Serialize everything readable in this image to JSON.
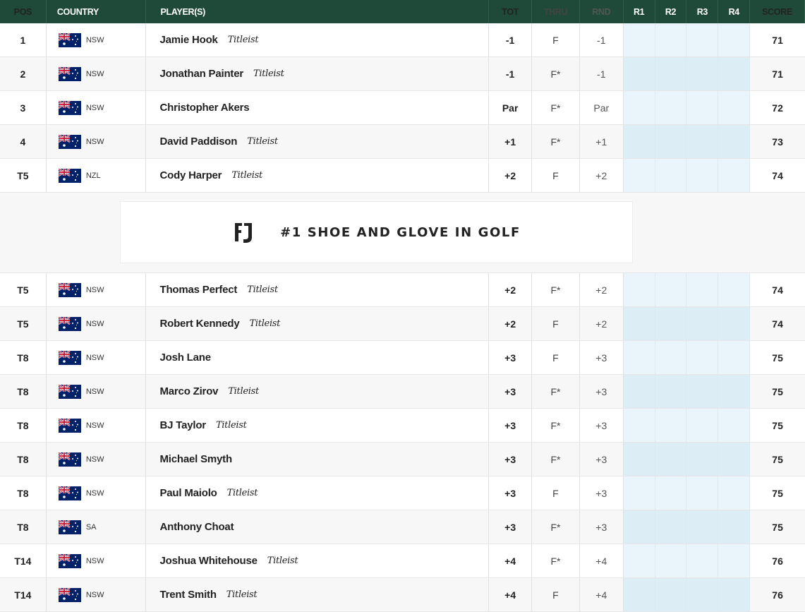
{
  "header": {
    "pos": "POS",
    "country": "COUNTRY",
    "players": "PLAYER(S)",
    "tot": "TOT",
    "thru": "THRU",
    "rnd": "RND",
    "r1": "R1",
    "r2": "R2",
    "r3": "R3",
    "r4": "R4",
    "score": "SCORE"
  },
  "rows_top": [
    {
      "pos": "1",
      "region": "NSW",
      "name": "Jamie Hook",
      "sponsor": "Titleist",
      "tot": "-1",
      "thru": "F",
      "rnd": "-1",
      "score": "71"
    },
    {
      "pos": "2",
      "region": "NSW",
      "name": "Jonathan Painter",
      "sponsor": "Titleist",
      "tot": "-1",
      "thru": "F*",
      "rnd": "-1",
      "score": "71"
    },
    {
      "pos": "3",
      "region": "NSW",
      "name": "Christopher Akers",
      "sponsor": "",
      "tot": "Par",
      "thru": "F*",
      "rnd": "Par",
      "score": "72"
    },
    {
      "pos": "4",
      "region": "NSW",
      "name": "David Paddison",
      "sponsor": "Titleist",
      "tot": "+1",
      "thru": "F*",
      "rnd": "+1",
      "score": "73"
    },
    {
      "pos": "T5",
      "region": "NZL",
      "name": "Cody Harper",
      "sponsor": "Titleist",
      "tot": "+2",
      "thru": "F",
      "rnd": "+2",
      "score": "74"
    }
  ],
  "ad": {
    "logo": "FJ",
    "text": "#1 SHOE AND GLOVE IN GOLF"
  },
  "rows_bottom": [
    {
      "pos": "T5",
      "region": "NSW",
      "name": "Thomas Perfect",
      "sponsor": "Titleist",
      "tot": "+2",
      "thru": "F*",
      "rnd": "+2",
      "score": "74"
    },
    {
      "pos": "T5",
      "region": "NSW",
      "name": "Robert Kennedy",
      "sponsor": "Titleist",
      "tot": "+2",
      "thru": "F",
      "rnd": "+2",
      "score": "74"
    },
    {
      "pos": "T8",
      "region": "NSW",
      "name": "Josh Lane",
      "sponsor": "",
      "tot": "+3",
      "thru": "F",
      "rnd": "+3",
      "score": "75"
    },
    {
      "pos": "T8",
      "region": "NSW",
      "name": "Marco Zirov",
      "sponsor": "Titleist",
      "tot": "+3",
      "thru": "F*",
      "rnd": "+3",
      "score": "75"
    },
    {
      "pos": "T8",
      "region": "NSW",
      "name": "BJ Taylor",
      "sponsor": "Titleist",
      "tot": "+3",
      "thru": "F*",
      "rnd": "+3",
      "score": "75"
    },
    {
      "pos": "T8",
      "region": "NSW",
      "name": "Michael Smyth",
      "sponsor": "",
      "tot": "+3",
      "thru": "F*",
      "rnd": "+3",
      "score": "75"
    },
    {
      "pos": "T8",
      "region": "NSW",
      "name": "Paul Maiolo",
      "sponsor": "Titleist",
      "tot": "+3",
      "thru": "F",
      "rnd": "+3",
      "score": "75"
    },
    {
      "pos": "T8",
      "region": "SA",
      "name": "Anthony Choat",
      "sponsor": "",
      "tot": "+3",
      "thru": "F*",
      "rnd": "+3",
      "score": "75"
    },
    {
      "pos": "T14",
      "region": "NSW",
      "name": "Joshua Whitehouse",
      "sponsor": "Titleist",
      "tot": "+4",
      "thru": "F*",
      "rnd": "+4",
      "score": "76"
    },
    {
      "pos": "T14",
      "region": "NSW",
      "name": "Trent Smith",
      "sponsor": "Titleist",
      "tot": "+4",
      "thru": "F",
      "rnd": "+4",
      "score": "76"
    }
  ],
  "colors": {
    "header_bg": "#1f4a3a",
    "round_cell": "#eaf5fb",
    "flag_blue": "#012169",
    "flag_red": "#c8102e"
  },
  "icons": {
    "flag": "australia-flag-icon",
    "ad_logo": "footjoy-logo-icon"
  }
}
